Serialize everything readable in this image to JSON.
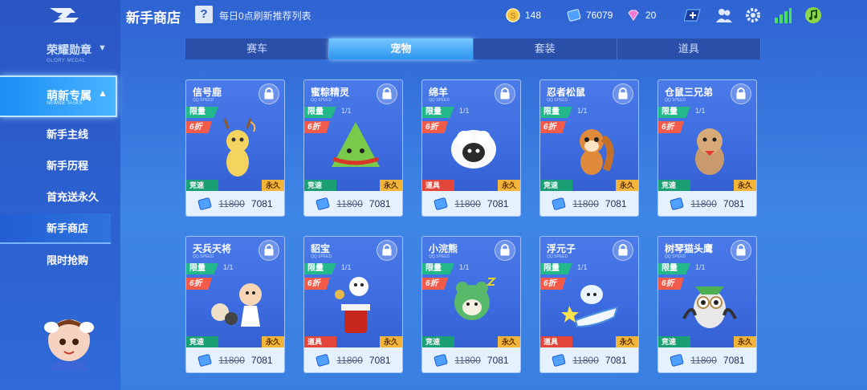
{
  "header": {
    "title": "新手商店",
    "help_label": "?",
    "refresh_note": "每日0点刷新推荐列表",
    "resources": [
      {
        "icon": "gold-coin-icon",
        "value": "148"
      },
      {
        "icon": "voucher-icon",
        "value": "76079"
      },
      {
        "icon": "diamond-icon",
        "value": "20"
      }
    ]
  },
  "sidebar": {
    "glory": {
      "label": "荣耀勋章",
      "sub": "GLORY MEDAL"
    },
    "active_group": {
      "label": "萌新专属",
      "sub": "NEWBIE TASKS"
    },
    "items": [
      {
        "label": "新手主线"
      },
      {
        "label": "新手历程"
      },
      {
        "label": "首充送永久"
      },
      {
        "label": "新手商店"
      },
      {
        "label": "限时抢购"
      }
    ]
  },
  "tabs": [
    "赛车",
    "宠物",
    "套装",
    "道具"
  ],
  "active_tab": 1,
  "cards": [
    {
      "name": "信号鹿",
      "sub": "QQ SPEED",
      "limit": "限量",
      "qty": "",
      "discount": "6折",
      "type": "竞速",
      "duration": "永久",
      "old_price": "11800",
      "price": "7081"
    },
    {
      "name": "蜜粽精灵",
      "sub": "QQ SPEED",
      "limit": "限量",
      "qty": "1/1",
      "discount": "6折",
      "type": "竞速",
      "duration": "永久",
      "old_price": "11800",
      "price": "7081"
    },
    {
      "name": "绵羊",
      "sub": "QQ SPEED",
      "limit": "限量",
      "qty": "1/1",
      "discount": "6折",
      "type": "道具",
      "duration": "永久",
      "old_price": "11800",
      "price": "7081"
    },
    {
      "name": "忍者松鼠",
      "sub": "QQ SPEED",
      "limit": "限量",
      "qty": "1/1",
      "discount": "6折",
      "type": "竞速",
      "duration": "永久",
      "old_price": "11800",
      "price": "7081"
    },
    {
      "name": "仓鼠三兄弟",
      "sub": "QQ SPEED",
      "limit": "限量",
      "qty": "1/1",
      "discount": "6折",
      "type": "竞速",
      "duration": "永久",
      "old_price": "11800",
      "price": "7081"
    },
    {
      "name": "天兵天将",
      "sub": "QQ SPEED",
      "limit": "限量",
      "qty": "1/1",
      "discount": "6折",
      "type": "竞速",
      "duration": "永久",
      "old_price": "11800",
      "price": "7081"
    },
    {
      "name": "貂宝",
      "sub": "QQ SPEED",
      "limit": "限量",
      "qty": "1/1",
      "discount": "6折",
      "type": "道具",
      "duration": "永久",
      "old_price": "11800",
      "price": "7081"
    },
    {
      "name": "小浣熊",
      "sub": "QQ SPEED",
      "limit": "限量",
      "qty": "1/1",
      "discount": "6折",
      "type": "竞速",
      "duration": "永久",
      "old_price": "11800",
      "price": "7081"
    },
    {
      "name": "浮元子",
      "sub": "QQ SPEED",
      "limit": "限量",
      "qty": "1/1",
      "discount": "6折",
      "type": "道具",
      "duration": "永久",
      "old_price": "11800",
      "price": "7081"
    },
    {
      "name": "树琴猫头鹰",
      "sub": "QQ SPEED",
      "limit": "限量",
      "qty": "1/1",
      "discount": "6折",
      "type": "竞速",
      "duration": "永久",
      "old_price": "11800",
      "price": "7081"
    }
  ],
  "colors": {
    "accent": "#2d95f0",
    "limit_tag": "#22b889",
    "discount_tag": "#f25a4a",
    "perm_tag": "#f2b53a"
  }
}
